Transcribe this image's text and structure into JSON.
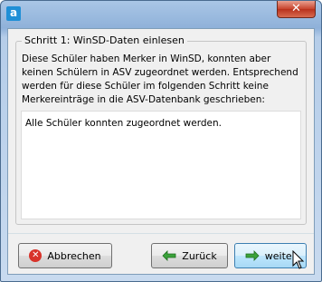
{
  "window": {
    "app_icon_letter": "a",
    "close_glyph": "✕"
  },
  "group": {
    "title": "Schritt 1: WinSD-Daten einlesen",
    "info_lines": [
      "Diese Schüler haben Merker in WinSD, konnten aber",
      "keinen Schülern in ASV zugeordnet werden. Entsprechend",
      "werden für diese Schüler im folgenden Schritt keine",
      "Merkereinträge in die ASV-Datenbank geschrieben:"
    ],
    "result_text": "Alle Schüler konnten zugeordnet werden."
  },
  "buttons": {
    "cancel_label": "Abbrechen",
    "back_label": "Zurück",
    "next_label": "weiter"
  },
  "icons": {
    "cancel": "cancel-circle-icon",
    "back": "arrow-left-icon",
    "next": "arrow-right-icon",
    "app": "app-logo-icon",
    "cursor": "mouse-pointer-icon"
  },
  "colors": {
    "cancel_red": "#d8332a",
    "arrow_green": "#3aa23a",
    "close_red": "#c7432c"
  }
}
